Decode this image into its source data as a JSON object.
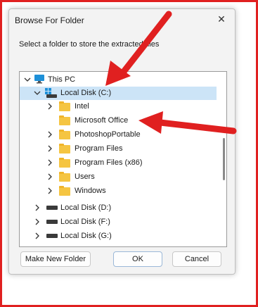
{
  "dialog": {
    "title": "Browse For Folder",
    "instruction": "Select a folder to store the extracted files",
    "close_glyph": "✕"
  },
  "tree": {
    "root": "This PC",
    "selected": "Local Disk (C:)",
    "children": [
      "Intel",
      "Microsoft Office",
      "PhotoshopPortable",
      "Program Files",
      "Program Files (x86)",
      "Users",
      "Windows"
    ],
    "drives": [
      "Local Disk (D:)",
      "Local Disk (F:)",
      "Local Disk (G:)"
    ]
  },
  "buttons": {
    "new_folder": "Make New Folder",
    "ok": "OK",
    "cancel": "Cancel"
  },
  "colors": {
    "arrow": "#e02020",
    "selection": "#cce4f7",
    "folder": "#f5c542"
  }
}
